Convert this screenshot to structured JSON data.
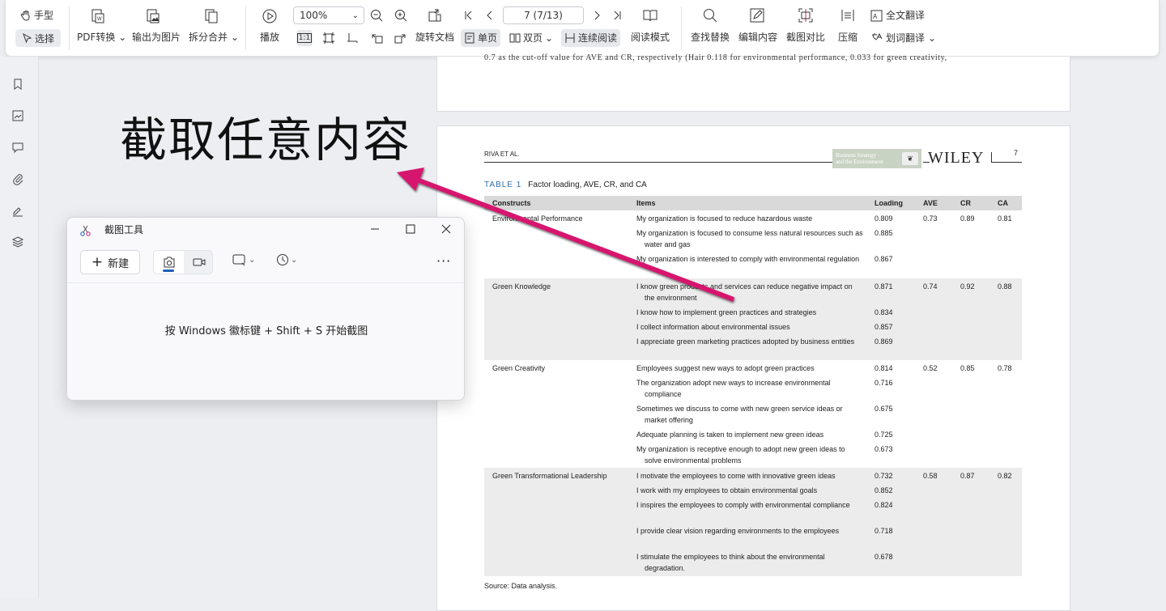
{
  "toolbar": {
    "hand_label": "手型",
    "select_label": "选择",
    "pdf_convert_label": "PDF转换",
    "export_image_label": "输出为图片",
    "split_merge_label": "拆分合并",
    "play_label": "播放",
    "zoom_value": "100%",
    "page_value": "7 (7/13)",
    "rotate_label": "旋转文档",
    "single_page_label": "单页",
    "double_page_label": "双页",
    "continuous_label": "连续阅读",
    "read_mode_label": "阅读模式",
    "find_replace_label": "查找替换",
    "edit_content_label": "编辑内容",
    "screenshot_compare_label": "截图对比",
    "compress_label": "压缩",
    "full_translate_label": "全文翻译",
    "word_translate_label": "划词翻译",
    "actual_size_label": "1:1"
  },
  "caption": "截取任意内容",
  "snip": {
    "title": "截图工具",
    "new_label": "新建",
    "hint": "按 Windows 徽标键 + Shift + S 开始截图"
  },
  "document": {
    "prev_page_text": "0.7 as the cut-off value for AVE and CR, respectively (Hair  0.118 for environmental performance, 0.033 for green creativity,",
    "header_left": "RIVA ET AL.",
    "journal_line1": "Business Strategy",
    "journal_line2": "and the Environment",
    "publisher": "WILEY",
    "page_number": "7",
    "table_label": "TABLE 1",
    "table_caption": "Factor loading, AVE, CR, and CA",
    "columns": [
      "Constructs",
      "Items",
      "Loading",
      "AVE",
      "CR",
      "CA"
    ],
    "groups": [
      {
        "construct": "Environmental Performance",
        "ave": "0.73",
        "cr": "0.89",
        "ca": "0.81",
        "rows": [
          {
            "item": "My organization is focused to reduce hazardous waste",
            "loading": "0.809"
          },
          {
            "item": "My organization is focused to consume less natural resources such as water and gas",
            "loading": "0.885"
          },
          {
            "item": "My organization is interested to comply with environmental regulation",
            "loading": "0.867"
          }
        ]
      },
      {
        "construct": "Green Knowledge",
        "ave": "0.74",
        "cr": "0.92",
        "ca": "0.88",
        "rows": [
          {
            "item": "I know green products and services can reduce negative impact on the environment",
            "loading": "0.871"
          },
          {
            "item": "I know how to implement green practices and strategies",
            "loading": "0.834"
          },
          {
            "item": "I collect information about environmental issues",
            "loading": "0.857"
          },
          {
            "item": "I appreciate green marketing practices adopted by business entities",
            "loading": "0.869"
          }
        ]
      },
      {
        "construct": "Green Creativity",
        "ave": "0.52",
        "cr": "0.85",
        "ca": "0.78",
        "rows": [
          {
            "item": "Employees suggest new ways to adopt green practices",
            "loading": "0.814"
          },
          {
            "item": "The organization adopt new ways to increase environmental compliance",
            "loading": "0.716"
          },
          {
            "item": "Sometimes we discuss to come with new green service ideas or market offering",
            "loading": "0.675"
          },
          {
            "item": "Adequate planning is taken to implement new green ideas",
            "loading": "0.725"
          },
          {
            "item": "My organization is receptive enough to adopt new green ideas to solve environmental problems",
            "loading": "0.673"
          }
        ]
      },
      {
        "construct": "Green Transformational Leadership",
        "ave": "0.58",
        "cr": "0.87",
        "ca": "0.82",
        "rows": [
          {
            "item": "I motivate the employees to come with innovative green ideas",
            "loading": "0.732"
          },
          {
            "item": "I work with my employees to obtain environmental goals",
            "loading": "0.852"
          },
          {
            "item": "I inspires the employees to comply with environmental compliance",
            "loading": "0.824"
          },
          {
            "item": "I provide clear vision regarding environments to the employees",
            "loading": "0.718"
          },
          {
            "item": "I stimulate the employees to think about the environmental degradation.",
            "loading": "0.678"
          }
        ]
      }
    ],
    "source": "Source: Data analysis."
  },
  "colors": {
    "arrow": "#d6196e",
    "table_header": "#d9d9d9",
    "table_shade": "#ececec",
    "accent": "#1a5fb4"
  }
}
